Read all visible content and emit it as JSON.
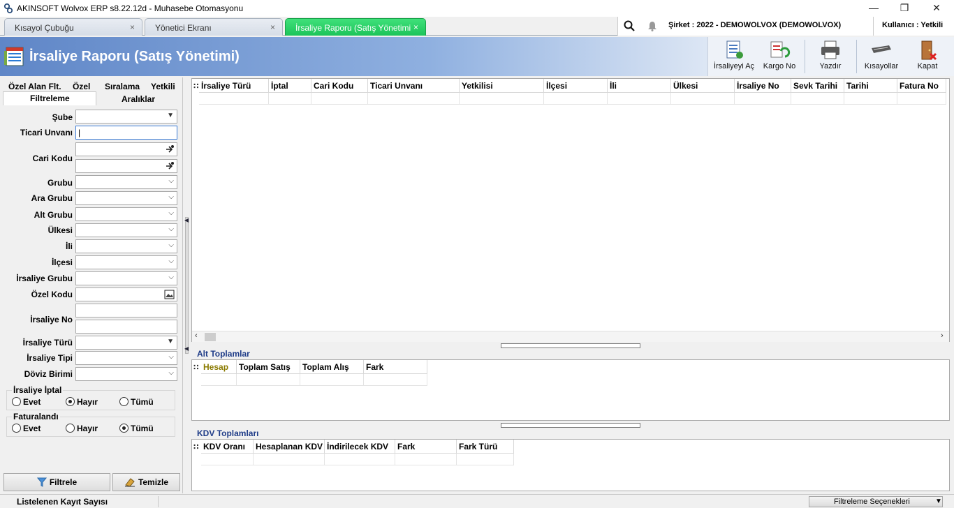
{
  "window": {
    "title": "AKINSOFT Wolvox ERP s8.22.12d - Muhasebe Otomasyonu",
    "minimize": "—",
    "restore": "❐",
    "close": "✕"
  },
  "tabs": [
    {
      "label": "Kısayol Çubuğu",
      "close": "×"
    },
    {
      "label": "Yönetici Ekranı",
      "close": "×"
    },
    {
      "label": "İrsaliye Raporu (Satış Yönetimi",
      "close": "×"
    }
  ],
  "topinfo": {
    "company": "Şirket : 2022 - DEMOWOLVOX (DEMOWOLVOX)",
    "user": "Kullanıcı : Yetkili"
  },
  "header": {
    "title": "İrsaliye Raporu (Satış Yönetimi)"
  },
  "toolbar": {
    "open": "İrsaliyeyi Aç",
    "cargo": "Kargo No",
    "print": "Yazdır",
    "shortcuts": "Kısayollar",
    "close": "Kapat"
  },
  "left_tabs": {
    "custom_field": "Özel Alan Flt.",
    "custom": "Özel",
    "sort": "Sıralama",
    "authority": "Yetkili",
    "filter": "Filtreleme",
    "ranges": "Aralıklar"
  },
  "filters": {
    "branch": "Şube",
    "title": "Ticari Unvanı",
    "title_value": "|",
    "account_code": "Cari Kodu",
    "group": "Grubu",
    "mid_group": "Ara Grubu",
    "sub_group": "Alt Grubu",
    "country": "Ülkesi",
    "city": "İli",
    "district": "İlçesi",
    "waybill_group": "İrsaliye Grubu",
    "special_code": "Özel Kodu",
    "waybill_no": "İrsaliye No",
    "waybill_kind": "İrsaliye Türü",
    "waybill_type": "İrsaliye Tipi",
    "currency": "Döviz Birimi"
  },
  "cancel_group": {
    "title": "İrsaliye İptal",
    "yes": "Evet",
    "no": "Hayır",
    "all": "Tümü"
  },
  "invoiced_group": {
    "title": "Faturalandı",
    "yes": "Evet",
    "no": "Hayır",
    "all": "Tümü"
  },
  "buttons": {
    "filter": "Filtrele",
    "clear": "Temizle"
  },
  "main_grid": {
    "columns": [
      "İrsaliye Türü",
      "İptal",
      "Cari Kodu",
      "Ticari Unvanı",
      "Yetkilisi",
      "İlçesi",
      "İli",
      "Ülkesi",
      "İrsaliye No",
      "Sevk Tarihi",
      "Tarihi",
      "Fatura No"
    ]
  },
  "sub_totals": {
    "title": "Alt Toplamlar",
    "columns": [
      "Hesap",
      "Toplam Satış",
      "Toplam Alış",
      "Fark"
    ]
  },
  "vat_totals": {
    "title": "KDV Toplamları",
    "columns": [
      "KDV Oranı",
      "Hesaplanan KDV",
      "İndirilecek KDV",
      "Fark",
      "Fark Türü"
    ]
  },
  "status": {
    "record_count": "Listelenen Kayıt Sayısı",
    "filter_options": "Filtreleme Seçenekleri"
  },
  "colors": {
    "active_tab": "#1cc45a",
    "header_start": "#5f86c7",
    "section_title": "#1f3c88",
    "hesap_header": "#8a7a00"
  }
}
